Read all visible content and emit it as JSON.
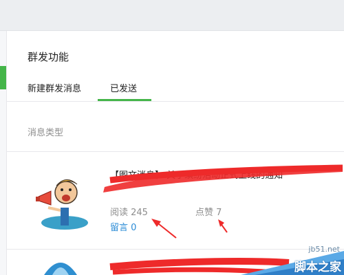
{
  "header": {
    "title": "群发功能"
  },
  "tabs": [
    {
      "label": "新建群发消息",
      "active": false
    },
    {
      "label": "已发送",
      "active": true
    }
  ],
  "section": {
    "label": "消息类型"
  },
  "message": {
    "title": "【图文消息】 关于缤纷活动正式上线的通知",
    "reads_label": "阅读 245",
    "likes_label": "点赞 7",
    "comment_label": "留言 0"
  },
  "watermark": {
    "top": "jb51.net",
    "bottom": "脚本之家"
  },
  "colors": {
    "accent_green": "#44b549",
    "link_blue": "#2a8bd6",
    "annotation_red": "#ee2a2a"
  }
}
